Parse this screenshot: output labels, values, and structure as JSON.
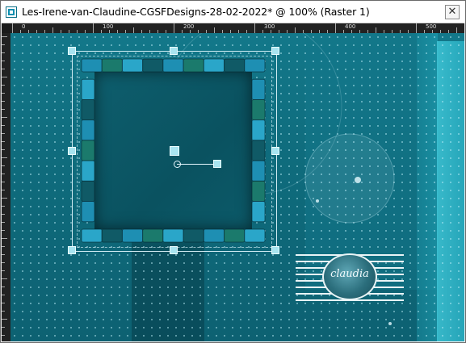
{
  "window": {
    "title": "Les-Irene-van-Claudine-CGSFDesigns-28-02-2022* @ 100% (Raster 1)",
    "close_symbol": "✕",
    "icon": "psp-document-icon"
  },
  "ruler": {
    "labels": [
      "0",
      "100",
      "200",
      "300",
      "400",
      "500"
    ]
  },
  "canvas": {
    "background": "#0f6c7d",
    "accent": "#2ab0c4",
    "frame_colors": [
      "#1e8fb3",
      "#1b7a6c",
      "#2aa6c9",
      "#105a66"
    ],
    "watermark_text": "claudia",
    "selection_handles": 9
  }
}
